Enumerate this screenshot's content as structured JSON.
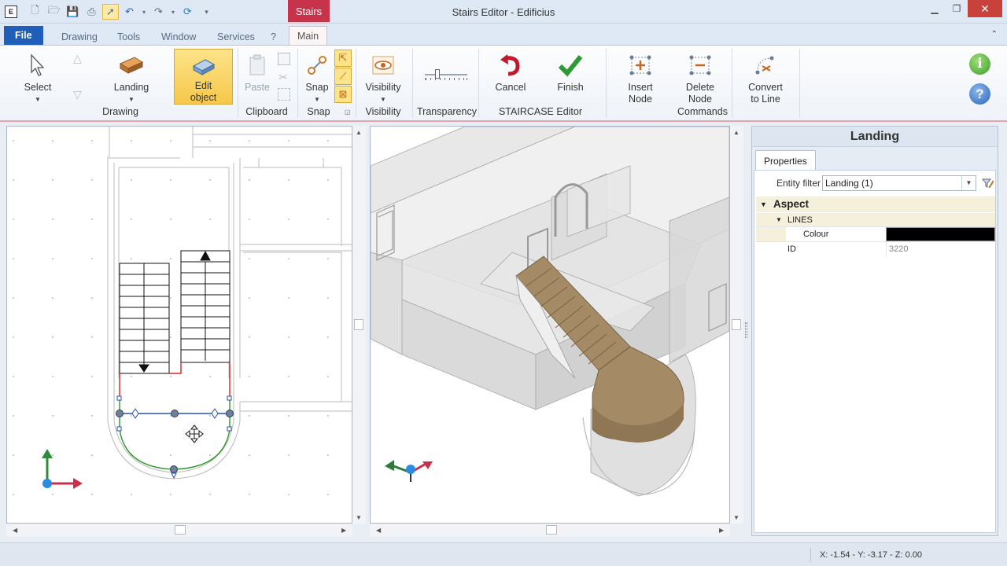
{
  "window": {
    "app_icon": "E",
    "title": "Stairs Editor - Edificius",
    "context_tab": "Stairs"
  },
  "tabs": {
    "file": "File",
    "drawing": "Drawing",
    "tools": "Tools",
    "window": "Window",
    "services": "Services",
    "help": "?",
    "main": "Main"
  },
  "ribbon": {
    "select": "Select",
    "landing": "Landing",
    "edit_object_1": "Edit",
    "edit_object_2": "object",
    "paste": "Paste",
    "snap": "Snap",
    "visibility": "Visibility",
    "cancel": "Cancel",
    "finish": "Finish",
    "insert_node_1": "Insert",
    "insert_node_2": "Node",
    "delete_node_1": "Delete",
    "delete_node_2": "Node",
    "convert_1": "Convert",
    "convert_2": "to Line",
    "groups": {
      "drawing": "Drawing",
      "clipboard": "Clipboard",
      "snap": "Snap",
      "visibility": "Visibility",
      "transparency": "Transparency",
      "staircase": "STAIRCASE Editor",
      "commands": "Commands"
    }
  },
  "panel": {
    "title": "Landing",
    "tab": "Properties",
    "filter_label": "Entity filter",
    "filter_value": "Landing (1)",
    "category": "Aspect",
    "subcategory": "LINES",
    "colour_label": "Colour",
    "colour_value": "#000000",
    "id_label": "ID",
    "id_value": "3220"
  },
  "status": {
    "coords": "X: -1.54 - Y: -3.17 - Z: 0.00"
  },
  "colors": {
    "accent": "#c7334a",
    "file_tab": "#1f5fb7",
    "stairs_fill": "#a58a66",
    "landing_selected": "#3aa336"
  }
}
